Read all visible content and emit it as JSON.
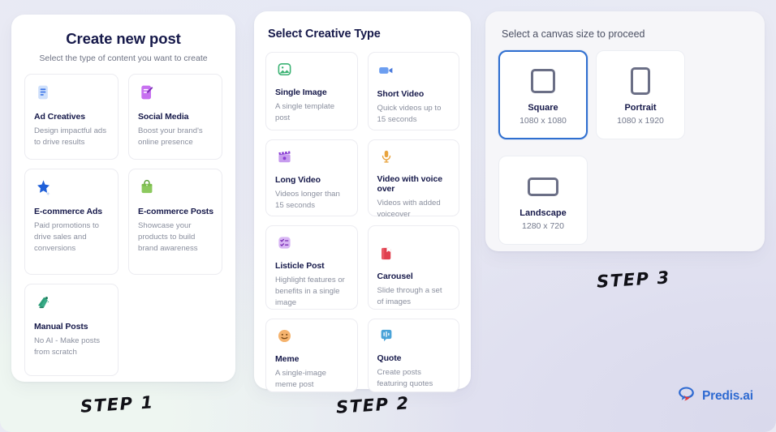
{
  "brand": {
    "name": "Predis.ai",
    "logo_icon": "speech-bubble-logo-icon",
    "color": "#2e6ad1"
  },
  "steps": {
    "step1": "STEP 1",
    "step2": "STEP 2",
    "step3": "STEP 3"
  },
  "create_post_panel": {
    "title": "Create new post",
    "subtitle": "Select the type of content you want to create",
    "options": [
      {
        "title": "Ad Creatives",
        "desc": "Design impactful ads to drive results",
        "icon": "document-lines-icon",
        "icon_color": "#4b7bec",
        "icon_bg": "#cfe0fb"
      },
      {
        "title": "Social Media",
        "desc": "Boost your brand's online presence",
        "icon": "document-pencil-icon",
        "icon_color": "#ffffff",
        "icon_bg": "#c770f0"
      },
      {
        "title": "E-commerce Ads",
        "desc": "Paid promotions to drive sales and conversions",
        "icon": "sparkle-star-icon",
        "icon_color": "#1f5fd8",
        "icon_bg": "transparent"
      },
      {
        "title": "E-commerce Posts",
        "desc": "Showcase your products to build brand awareness",
        "icon": "shopping-bag-icon",
        "icon_color": "#74bb46",
        "icon_bg": "transparent"
      },
      {
        "title": "Manual Posts",
        "desc": "No AI - Make posts from scratch",
        "icon": "megaphone-hand-icon",
        "icon_color": "#2b9e78",
        "icon_bg": "transparent"
      }
    ]
  },
  "creative_type_panel": {
    "title": "Select Creative Type",
    "options": [
      {
        "title": "Single Image",
        "desc": "A single template post",
        "icon": "image-photo-icon",
        "icon_color": "#3bb273",
        "icon_bg": "#d8f2e3"
      },
      {
        "title": "Short Video",
        "desc": "Quick videos up to 15 seconds",
        "icon": "video-camera-icon",
        "icon_color": "#6c9ef0",
        "icon_bg": "transparent"
      },
      {
        "title": "Long Video",
        "desc": "Videos longer than 15 seconds",
        "icon": "film-clapper-icon",
        "icon_color": "#8b3fd4",
        "icon_bg": "#e6d2f8"
      },
      {
        "title": "Video with voice over",
        "desc": "Videos with added voiceover",
        "icon": "microphone-icon",
        "icon_color": "#e8a33d",
        "icon_bg": "transparent"
      },
      {
        "title": "Listicle Post",
        "desc": "Highlight features or benefits in a single image",
        "icon": "checklist-icon",
        "icon_color": "#8b3fd4",
        "icon_bg": "#e6d2f8"
      },
      {
        "title": "Carousel",
        "desc": "Slide through a set of images",
        "icon": "carousel-cards-icon",
        "icon_color": "#e0404f",
        "icon_bg": "transparent"
      },
      {
        "title": "Meme",
        "desc": "A single-image meme post",
        "icon": "smiley-face-icon",
        "icon_color": "#f0a85c",
        "icon_bg": "transparent"
      },
      {
        "title": "Quote",
        "desc": "Create posts featuring quotes",
        "icon": "quote-bubble-icon",
        "icon_color": "#4aa3d8",
        "icon_bg": "transparent"
      }
    ]
  },
  "canvas_panel": {
    "title": "Select a canvas size to proceed",
    "selected": "Square",
    "accent_color": "#2f6fd0",
    "sizes": [
      {
        "label": "Square",
        "dims": "1080 x 1080",
        "shape": "square-shape-icon",
        "selected": true
      },
      {
        "label": "Portrait",
        "dims": "1080 x 1920",
        "shape": "portrait-shape-icon",
        "selected": false
      },
      {
        "label": "Landscape",
        "dims": "1280 x 720",
        "shape": "landscape-shape-icon",
        "selected": false
      }
    ]
  }
}
